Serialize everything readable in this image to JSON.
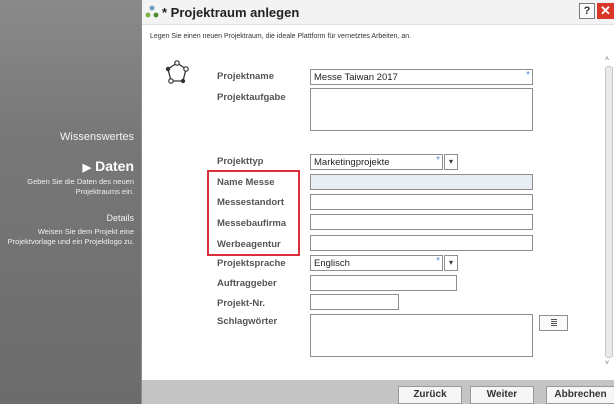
{
  "sidebar": {
    "section_title": "Wissenswertes",
    "step_active": "Daten",
    "step_active_desc": "Geben Sie die Daten des neuen Projektraums ein.",
    "step_next": "Details",
    "step_next_desc": "Weisen Sie dem Projekt eine Projektvorlage und ein Projektlogo zu."
  },
  "dialog": {
    "title": "* Projektraum anlegen",
    "help_label": "?",
    "close_label": "✕",
    "subtitle": "Legen Sie einen neuen Projektraum, die ideale Plattform für vernetztes Arbeiten, an."
  },
  "form": {
    "projektname_label": "Projektname",
    "projektname_value": "Messe Taiwan 2017",
    "projektaufgabe_label": "Projektaufgabe",
    "projektaufgabe_value": "",
    "projekttyp_label": "Projekttyp",
    "projekttyp_value": "Marketingprojekte",
    "name_messe_label": "Name Messe",
    "name_messe_value": "",
    "messestandort_label": "Messestandort",
    "messestandort_value": "",
    "messebaufirma_label": "Messebaufirma",
    "messebaufirma_value": "",
    "werbeagentur_label": "Werbeagentur",
    "werbeagentur_value": "",
    "projektsprache_label": "Projektsprache",
    "projektsprache_value": "Englisch",
    "auftraggeber_label": "Auftraggeber",
    "auftraggeber_value": "",
    "projektnr_label": "Projekt-Nr.",
    "projektnr_value": "",
    "schlagwoerter_label": "Schlagwörter",
    "schlagwoerter_value": "",
    "required_mark": "*",
    "dropdown_glyph": "▾",
    "scroll_up": "˄",
    "scroll_down": "˅"
  },
  "footer": {
    "back_label": "Zurück",
    "next_label": "Weiter",
    "cancel_label": "Abbrechen"
  },
  "colors": {
    "highlight_border": "#d9303c",
    "close_button": "#d9372a",
    "required_star": "#5b8fd3"
  }
}
